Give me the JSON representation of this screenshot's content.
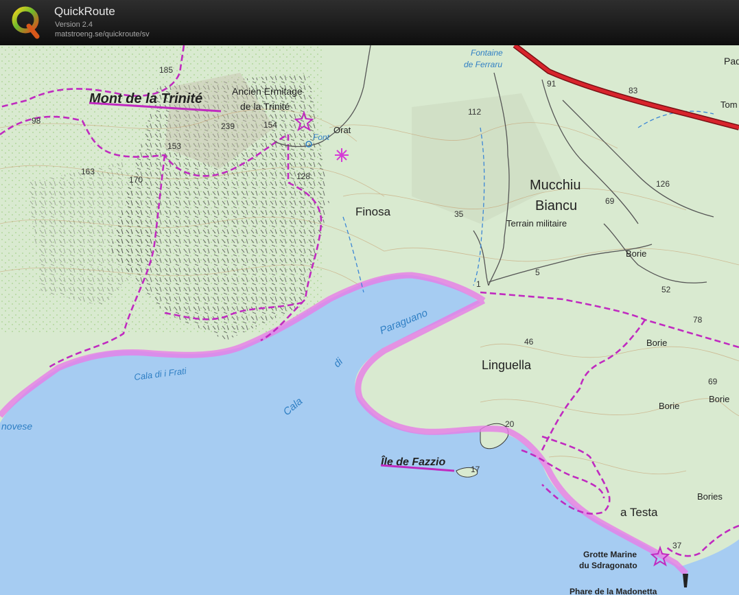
{
  "app": {
    "title": "QuickRoute",
    "version": "Version 2.4",
    "url": "matstroeng.se/quickroute/sv",
    "logo_letter": "Q"
  },
  "map": {
    "place_labels": {
      "mont_trinite": "Mont de la Trinité",
      "ermitage_line1": "Ancien Ermitage",
      "ermitage_line2": "de la Trinité",
      "font": "Font",
      "orat": "Orat",
      "fontaine_line1": "Fontaine",
      "fontaine_line2": "de Ferraru",
      "finosa": "Finosa",
      "mucchiu_line1": "Mucchiu",
      "mucchiu_line2": "Biancu",
      "terrain": "Terrain militaire",
      "borie_1": "Borie",
      "borie_2": "Borie",
      "borie_3": "Borie",
      "borie_4": "Borie",
      "bories": "Bories",
      "linguella": "Linguella",
      "ile_fazzio": "Île de Fazzio",
      "a_testa": "a Testa",
      "grotte_line1": "Grotte Marine",
      "grotte_line2": "du Sdragonato",
      "phare": "Phare de la Madonetta",
      "pad": "Pad",
      "tom": "Tom"
    },
    "water_labels": {
      "paraguano": "Paraguano",
      "di": "di",
      "cala": "Cala",
      "cala_frati": "Cala di i Frati",
      "novese": "novese"
    },
    "spot_heights": {
      "h185": "185",
      "h98": "98",
      "h239": "239",
      "h154": "154",
      "h153": "153",
      "h163": "163",
      "h170": "170",
      "h128": "128",
      "h112": "112",
      "h91": "91",
      "h83": "83",
      "h35": "35",
      "h69a": "69",
      "h126": "126",
      "h5": "5",
      "h52": "52",
      "h78": "78",
      "h46": "46",
      "h69b": "69",
      "h20": "20",
      "h17": "17",
      "h37": "37",
      "h1": "1"
    },
    "colors": {
      "sea": "#a6ccf2",
      "land": "#d9ead0",
      "route": "#d63ad6",
      "route_glow": "#e77de7",
      "road": "#d8242c",
      "water_text": "#2f7fc4"
    }
  }
}
